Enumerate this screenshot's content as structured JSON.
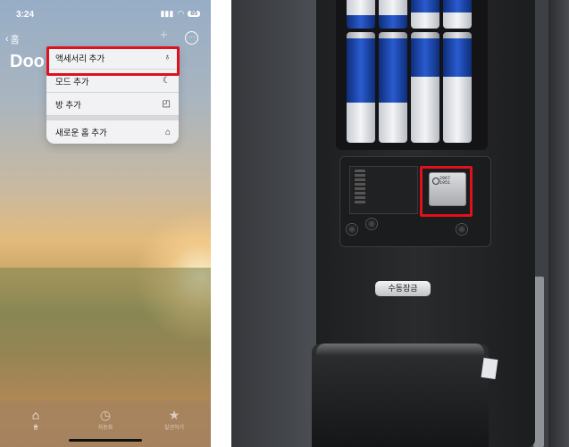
{
  "phone": {
    "status": {
      "time": "3:24",
      "signal": "▮▮▮",
      "wifi": "◠",
      "battery": "85"
    },
    "nav": {
      "back_label": "홈",
      "plus": "+",
      "more": "···"
    },
    "home_title": "Doo",
    "menu": {
      "items": [
        {
          "label": "액세서리 추가",
          "icon": "lightbulb-icon",
          "glyph": "♁"
        },
        {
          "label": "모드 추가",
          "icon": "moon-icon",
          "glyph": "☾"
        },
        {
          "label": "방 추가",
          "icon": "room-icon",
          "glyph": "◰"
        },
        {
          "label": "새로운 홈 추가",
          "icon": "house-icon",
          "glyph": "⌂"
        }
      ],
      "highlighted_index": 0
    },
    "tabbar": {
      "tabs": [
        {
          "label": "홈",
          "icon": "house-fill-icon",
          "glyph": "⌂",
          "active": true
        },
        {
          "label": "자동화",
          "icon": "clock-check-icon",
          "glyph": "◷",
          "active": false
        },
        {
          "label": "발견하기",
          "icon": "star-icon",
          "glyph": "★",
          "active": false
        }
      ]
    }
  },
  "photo": {
    "manual_lock_label": "수동잠금",
    "chip_text": [
      "2967",
      "1951"
    ],
    "highlight_color": "#e0101c"
  }
}
